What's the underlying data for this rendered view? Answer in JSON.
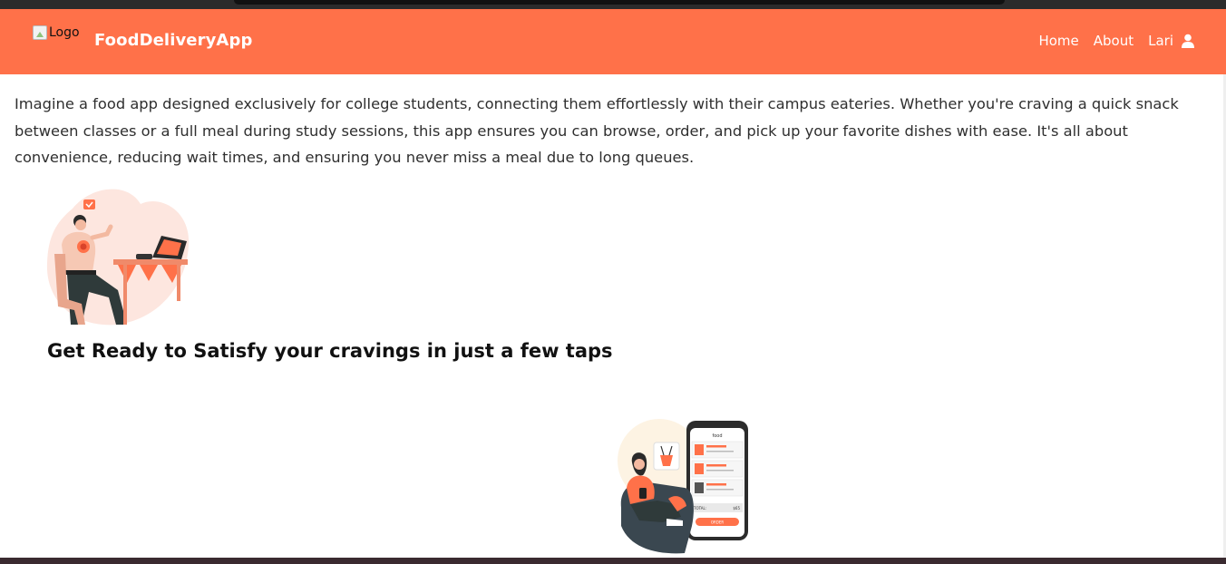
{
  "navbar": {
    "logo_alt": "Logo",
    "brand": "FoodDeliveryApp",
    "links": [
      {
        "label": "Home"
      },
      {
        "label": "About"
      }
    ],
    "user": {
      "name": "Lari",
      "icon": "user-icon"
    },
    "color": "#ff7149"
  },
  "main": {
    "intro_text": "Imagine a food app designed exclusively for college students, connecting them effortlessly with their campus eateries. Whether you're craving a quick snack between classes or a full meal during study sessions, this app ensures you can browse, order, and pick up your favorite dishes with ease. It's all about convenience, reducing wait times, and ensuring you never miss a meal due to long queues.",
    "headline": "Get Ready to Satisfy your cravings in just a few taps",
    "illustrations": [
      {
        "name": "person-eating-pizza-illustration"
      },
      {
        "name": "woman-ordering-on-phone-illustration",
        "phone_title": "food",
        "phone_total_label": "TOTAL:",
        "phone_total_value": "$65",
        "phone_button": "ORDER"
      }
    ]
  }
}
